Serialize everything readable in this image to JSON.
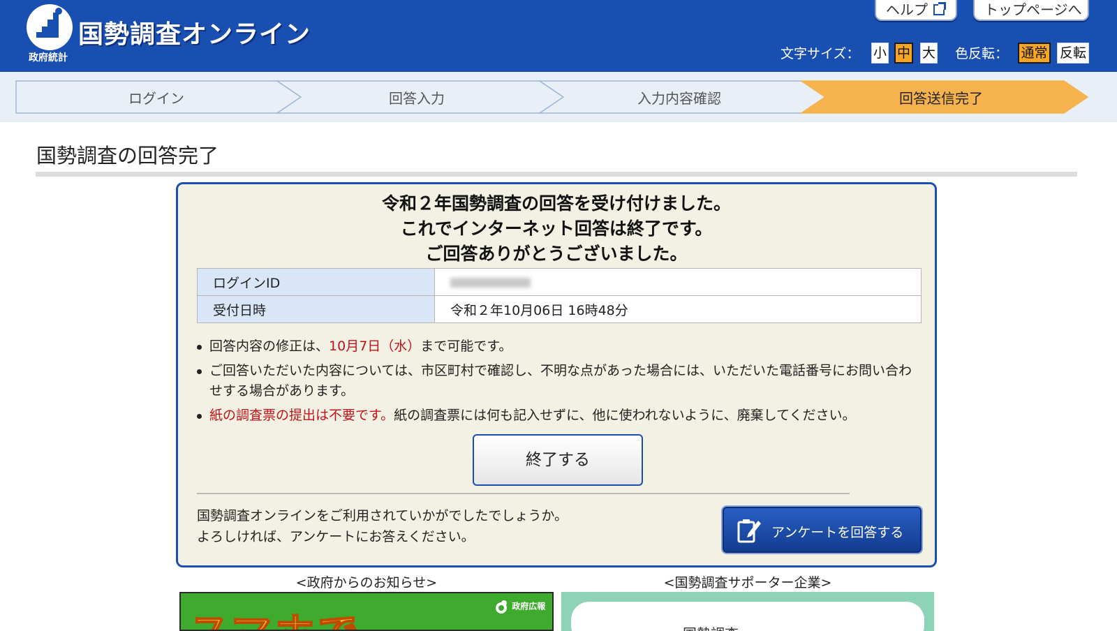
{
  "header": {
    "site_title": "国勢調査オンライン",
    "site_sub": "政府統計",
    "help_label": "ヘルプ",
    "top_label": "トップページへ",
    "font_size_label": "文字サイズ：",
    "font_sizes": [
      "小",
      "中",
      "大"
    ],
    "font_size_selected": "中",
    "color_invert_label": "色反転：",
    "color_modes": [
      "通常",
      "反転"
    ],
    "color_mode_selected": "通常"
  },
  "progress": {
    "steps": [
      "ログイン",
      "回答入力",
      "入力内容確認",
      "回答送信完了"
    ],
    "current": "回答送信完了"
  },
  "page": {
    "title": "国勢調査の回答完了"
  },
  "message": {
    "line1": "令和２年国勢調査の回答を受け付けました。",
    "line2": "これでインターネット回答は終了です。",
    "line3": "ご回答ありがとうございました。"
  },
  "info": {
    "login_id_label": "ログインID",
    "received_label": "受付日時",
    "received_value": "令和２年10月06日 16時48分"
  },
  "notes": {
    "n1_prefix": "回答内容の修正は、",
    "n1_date": "10月7日（水）",
    "n1_suffix": "まで可能です。",
    "n2": "ご回答いただいた内容については、市区町村で確認し、不明な点があった場合には、いただいた電話番号にお問い合わせする場合があります。",
    "n3_red": "紙の調査票の提出は不要です。",
    "n3_rest": "紙の調査票には何も記入せずに、他に使われないように、廃棄してください。"
  },
  "buttons": {
    "end": "終了する",
    "survey": "アンケートを回答する"
  },
  "survey": {
    "line1": "国勢調査オンラインをご利用されていかがでしたでしょうか。",
    "line2": "よろしければ、アンケートにお答えください。"
  },
  "bottom": {
    "gov_notice_label": "<政府からのお知らせ>",
    "supporter_label": "<国勢調査サポーター企業>",
    "banner_left_text": "スマホで",
    "banner_left_badge": "政府広報",
    "banner_right_text": "国勢調査"
  },
  "colors": {
    "header_blue": "#1a4fb2",
    "current_step": "#f6b24c",
    "accent_orange": "#f6a623",
    "alert_red": "#c0141a",
    "box_bg": "#f2f1e3"
  }
}
